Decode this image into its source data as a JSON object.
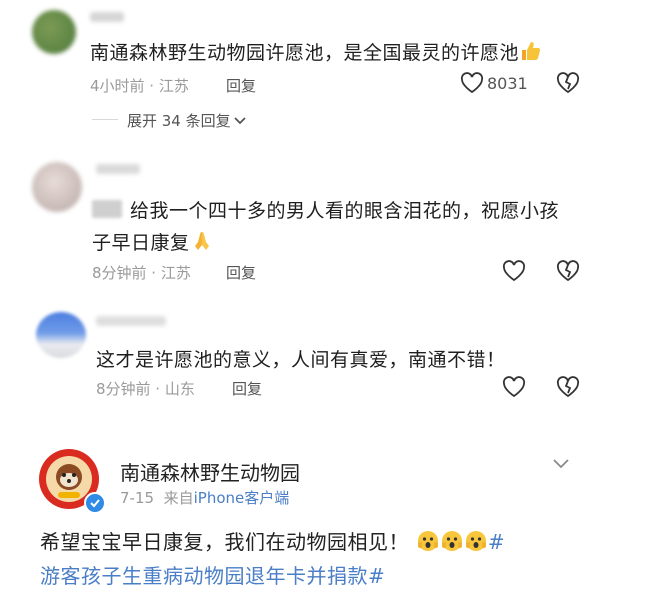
{
  "comments": [
    {
      "text": "南通森林野生动物园许愿池，是全国最灵的许愿池",
      "time_loc": "4小时前 · 江苏",
      "reply_label": "回复",
      "like_count": "8031",
      "expand_label": "展开 34 条回复"
    },
    {
      "text_line1": "给我一个四十多的男人看的眼含泪花的，祝愿小孩",
      "text_line2": "子早日康复",
      "time_loc": "8分钟前 · 江苏",
      "reply_label": "回复"
    },
    {
      "text": "这才是许愿池的意义，人间有真爱，南通不错！",
      "time_loc": "8分钟前 · 山东",
      "reply_label": "回复"
    }
  ],
  "post": {
    "account_name": "南通森林野生动物园",
    "date": "7-15",
    "source_prefix": "来自",
    "source_device": "iPhone客户端",
    "text": "希望宝宝早日康复，我们在动物园相见！",
    "hashtag_start": "#",
    "hashtag_line2": "游客孩子生重病动物园退年卡并捐款#"
  },
  "colors": {
    "link": "#4a7ec7",
    "meta": "#9a9a9a"
  }
}
